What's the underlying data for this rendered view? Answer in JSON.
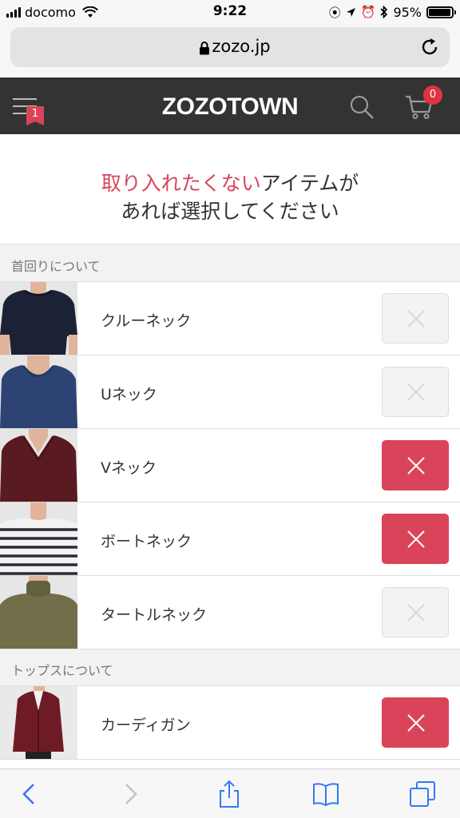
{
  "status_bar": {
    "carrier": "docomo",
    "time": "9:22",
    "battery_percent": "95%",
    "battery_level": 0.95
  },
  "browser": {
    "url": "zozo.jp"
  },
  "header": {
    "logo": "ZOZOTOWN",
    "menu_badge": "1",
    "cart_count": "0"
  },
  "heading": {
    "highlight": "取り入れたくない",
    "line1_rest": "アイテムが",
    "line2": "あれば選択してください"
  },
  "sections": [
    {
      "title": "首回りについて",
      "items": [
        {
          "label": "クルーネック",
          "selected": false
        },
        {
          "label": "Uネック",
          "selected": false
        },
        {
          "label": "Vネック",
          "selected": true
        },
        {
          "label": "ボートネック",
          "selected": true
        },
        {
          "label": "タートルネック",
          "selected": false
        }
      ]
    },
    {
      "title": "トップスについて",
      "items": [
        {
          "label": "カーディガン",
          "selected": true
        }
      ]
    }
  ],
  "colors": {
    "accent": "#d9445a",
    "header_bg": "#333333",
    "cart_badge": "#e0323f",
    "link_blue": "#3478f6"
  }
}
